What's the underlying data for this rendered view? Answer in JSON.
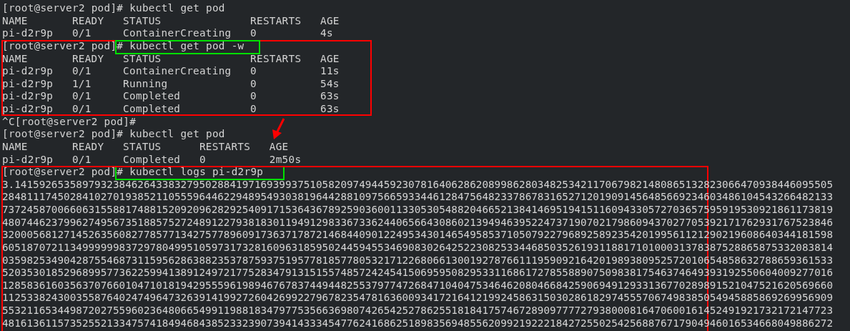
{
  "terminal": {
    "blocks": [
      {
        "kind": "line",
        "text": "[root@server2 pod]# kubectl get pod"
      },
      {
        "kind": "table",
        "header": [
          "NAME",
          "READY",
          "STATUS",
          "RESTARTS",
          "AGE"
        ],
        "rows": [
          [
            "pi-d2r9p",
            "0/1",
            "ContainerCreating",
            "0",
            "4s"
          ]
        ]
      },
      {
        "kind": "line",
        "text": "[root@server2 pod]# kubectl get pod -w"
      },
      {
        "kind": "table",
        "header": [
          "NAME",
          "READY",
          "STATUS",
          "RESTARTS",
          "AGE"
        ],
        "rows": [
          [
            "pi-d2r9p",
            "0/1",
            "ContainerCreating",
            "0",
            "11s"
          ],
          [
            "pi-d2r9p",
            "1/1",
            "Running",
            "0",
            "54s"
          ],
          [
            "pi-d2r9p",
            "0/1",
            "Completed",
            "0",
            "63s"
          ],
          [
            "pi-d2r9p",
            "0/1",
            "Completed",
            "0",
            "63s"
          ]
        ]
      },
      {
        "kind": "line",
        "text": "^C[root@server2 pod]#"
      },
      {
        "kind": "line",
        "text": "[root@server2 pod]# kubectl get pod"
      },
      {
        "kind": "table",
        "header": [
          "NAME",
          "READY",
          "STATUS",
          "RESTARTS",
          "AGE"
        ],
        "rows": [
          [
            "pi-d2r9p",
            "0/1",
            "Completed",
            "0",
            "2m50s"
          ]
        ]
      },
      {
        "kind": "line",
        "text": "[root@server2 pod]# kubectl logs pi-d2r9p"
      },
      {
        "kind": "output",
        "lines": [
          "3.1415926535897932384626433832795028841971693993751058209749445923078164062862089986280348253421170679821480865132823066470938446095505",
          "284811174502841027019385211055596446229489549303819644288109756659334461284756482337867831652712019091456485669234603486104543266482133",
          "737245870066063155881748815209209628292540917153643678925903600113305305488204665213841469519415116094330572703657595919530921861173819",
          "480744623799627495673518857527248912279381830119491298336733624406566430860213949463952247371907021798609437027705392171762931767523846",
          "320005681271452635608277857713427577896091736371787214684409012249534301465495853710507922796892589235420199561121290219608640344181598",
          "605187072113499999983729780499510597317328160963185950244594553469083026425223082533446850352619311881710100031378387528865875332083814",
          "035982534904287554687311595628638823537875937519577818577805321712268066130019278766111959092164201989380952572010654858632788659361533",
          "520353018529689957736225994138912497217752834791315155748572424541506959508295331168617278558890750983817546374649393192550604009277016",
          "128583616035637076601047101819429555961989467678374494482553797747268471040475346462080466842590694912933136770289891521047521620569660",
          "112533824300355876402474964732639141992726042699227967823547816360093417216412199245863150302861829745557067498385054945885869269956909",
          "553211653449872027559602364806654991198818347977535663698074265425278625518184175746728909777727938000816470600161452491921732172147723",
          "481613611573525521334757418494684385233239073941433345477624168625189835694855620992192221842725502542568876717904946016534668049886272"
        ]
      }
    ]
  },
  "annotations": [
    {
      "kind": "box",
      "color": "#ff0000"
    },
    {
      "kind": "box",
      "color": "#00e000"
    },
    {
      "kind": "arrow",
      "color": "#ff0000"
    },
    {
      "kind": "box",
      "color": "#00e000"
    },
    {
      "kind": "box",
      "color": "#ff0000"
    }
  ]
}
